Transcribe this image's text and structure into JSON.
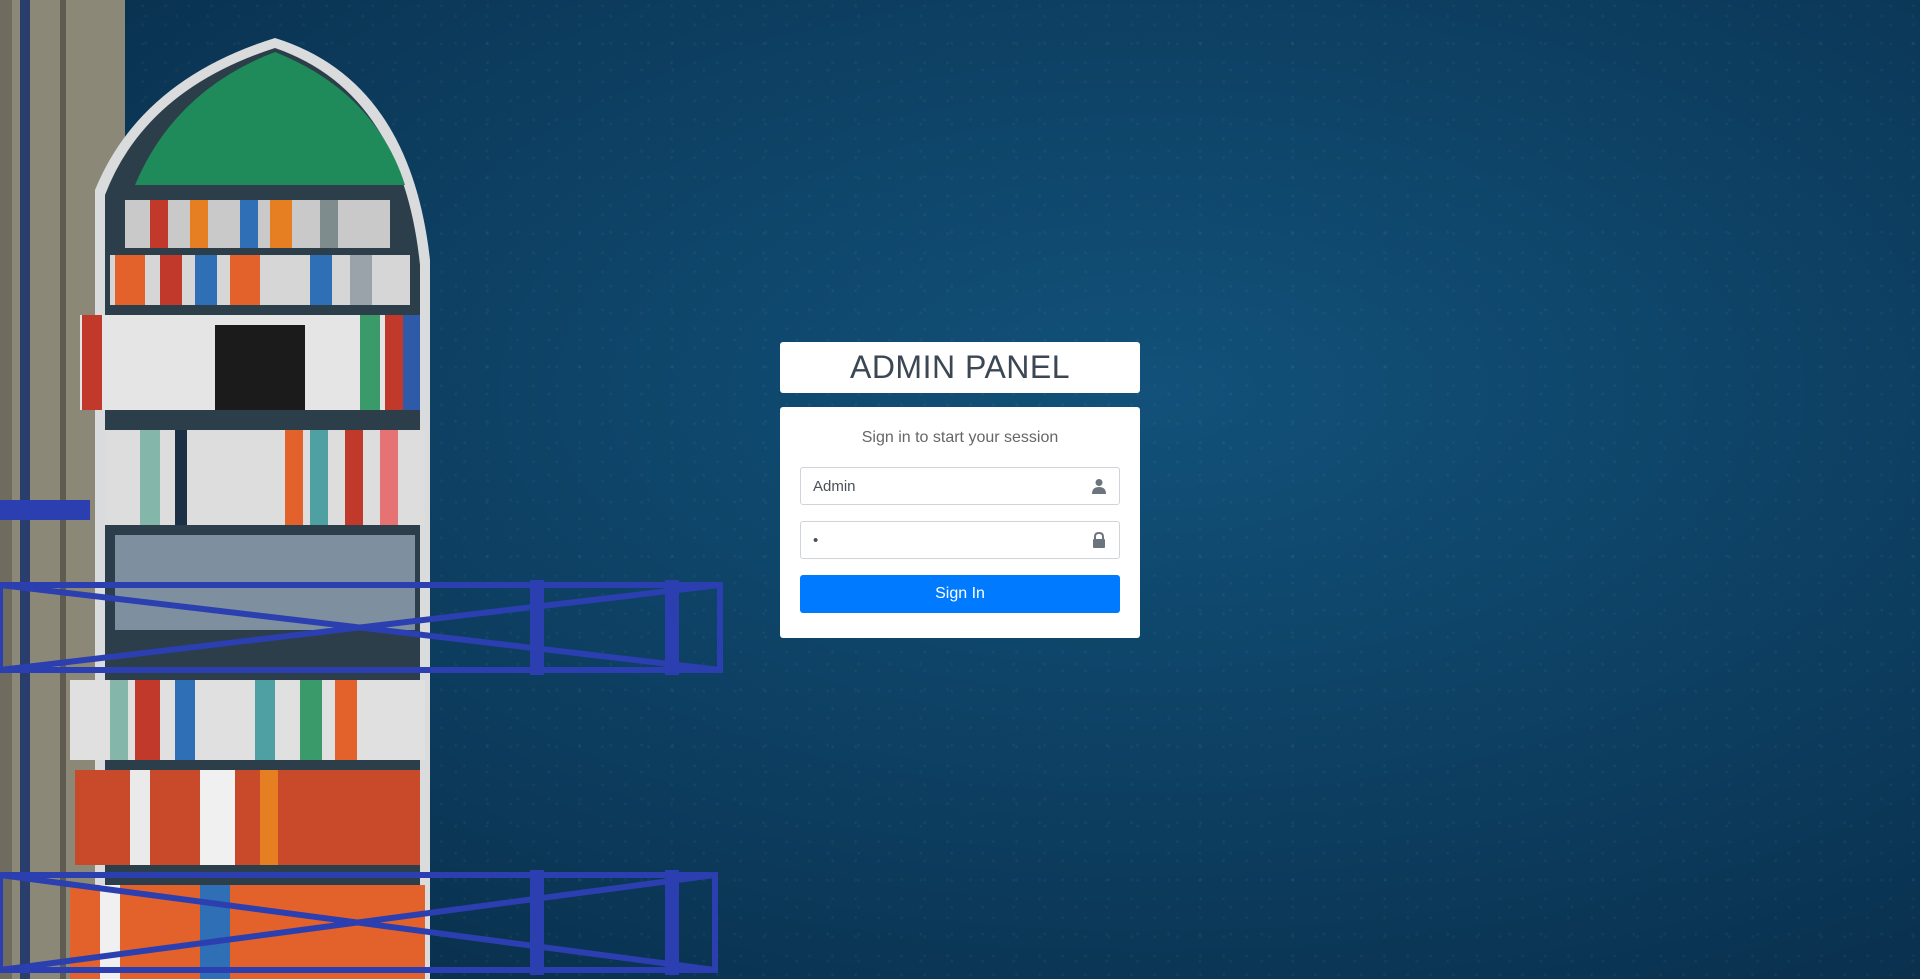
{
  "app": {
    "title": "ADMIN PANEL"
  },
  "login": {
    "message": "Sign in to start your session",
    "username_value": "Admin",
    "password_value": "•",
    "submit_label": "Sign In"
  },
  "icons": {
    "username": "user-icon",
    "password": "lock-icon"
  },
  "colors": {
    "primary": "#007bff",
    "background": "#0e4468"
  }
}
